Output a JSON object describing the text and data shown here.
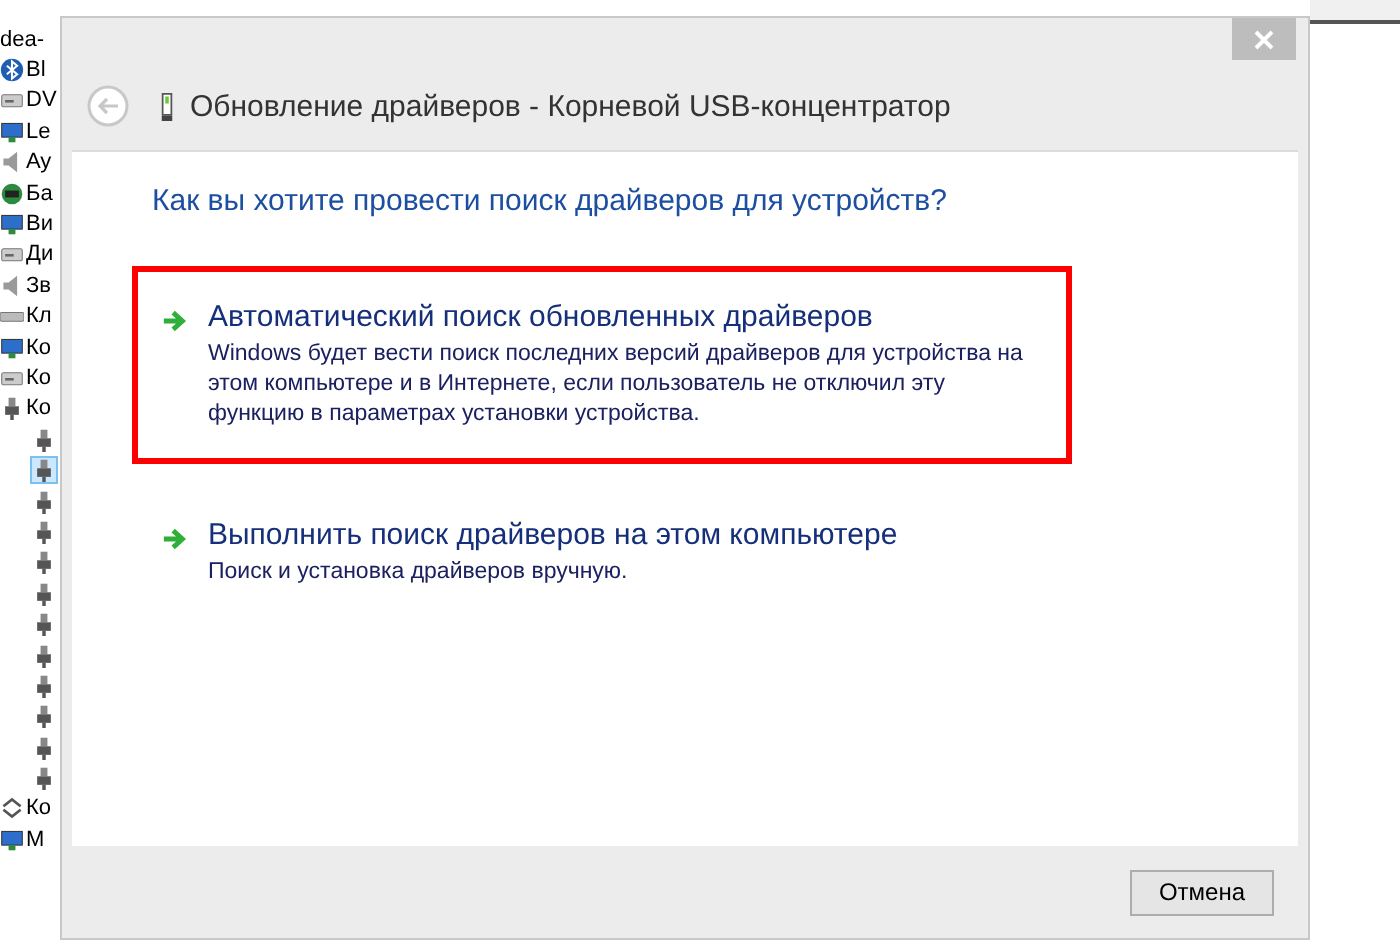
{
  "device_tree": {
    "root": "dea-",
    "items": [
      {
        "kind": "bluetooth",
        "label": "Bl"
      },
      {
        "kind": "drive",
        "label": "DV"
      },
      {
        "kind": "network",
        "label": "Le"
      },
      {
        "kind": "speaker",
        "label": "Ay"
      },
      {
        "kind": "battery",
        "label": "Ба"
      },
      {
        "kind": "display",
        "label": "Ви"
      },
      {
        "kind": "disk",
        "label": "Ди"
      },
      {
        "kind": "speaker",
        "label": "Зв"
      },
      {
        "kind": "keyboard",
        "label": "Кл"
      },
      {
        "kind": "monitor",
        "label": "Ко"
      },
      {
        "kind": "controller",
        "label": "Ко"
      },
      {
        "kind": "usb",
        "label": "Ко",
        "children": [
          {
            "selected": false
          },
          {
            "selected": true
          },
          {
            "selected": false
          },
          {
            "selected": false
          },
          {
            "selected": false
          },
          {
            "selected": false
          },
          {
            "selected": false
          },
          {
            "selected": false
          },
          {
            "selected": false
          },
          {
            "selected": false
          },
          {
            "selected": false
          },
          {
            "selected": false
          }
        ]
      },
      {
        "kind": "arrows",
        "label": "Ко"
      },
      {
        "kind": "monitor",
        "label": "М"
      }
    ]
  },
  "dialog": {
    "title": "Обновление драйверов - Корневой USB-концентратор",
    "question": "Как вы хотите провести поиск драйверов для устройств?",
    "options": [
      {
        "title": "Автоматический поиск обновленных драйверов",
        "description": "Windows будет вести поиск последних версий драйверов для устройства на этом компьютере и в Интернете, если пользователь не отключил эту функцию в параметрах установки устройства.",
        "highlighted": true
      },
      {
        "title": "Выполнить поиск драйверов на этом компьютере",
        "description": "Поиск и установка драйверов вручную.",
        "highlighted": false
      }
    ],
    "buttons": [
      "Отмена"
    ]
  }
}
